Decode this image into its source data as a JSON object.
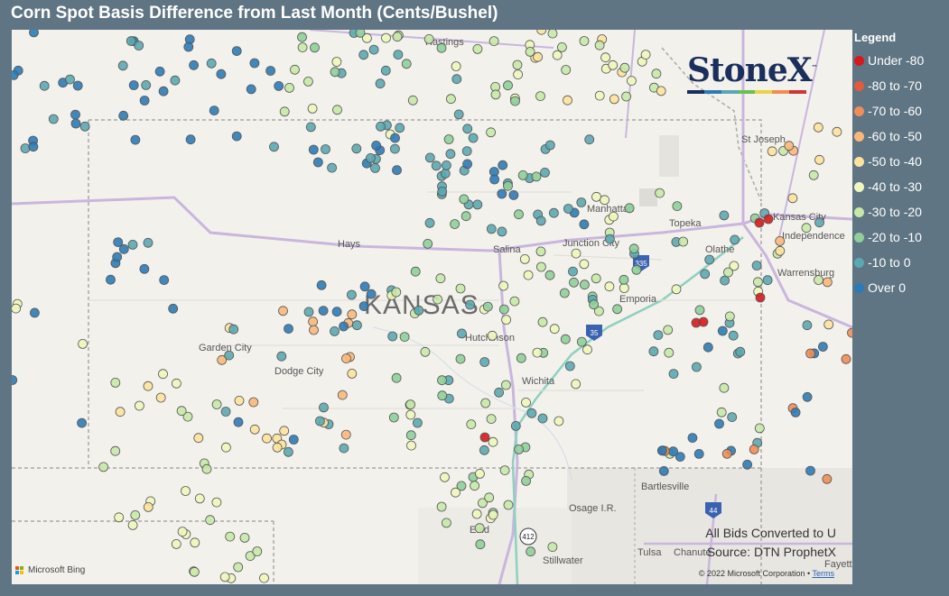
{
  "title": "Corn Spot Basis Difference from Last Month (Cents/Bushel)",
  "legend": {
    "title": "Legend",
    "items": [
      {
        "label": "Under -80",
        "color": "#d7191c"
      },
      {
        "label": "-80 to -70",
        "color": "#e45a3a"
      },
      {
        "label": "-70 to -60",
        "color": "#f08d55"
      },
      {
        "label": "-60 to -50",
        "color": "#f9b87a"
      },
      {
        "label": "-50 to -40",
        "color": "#fde39c"
      },
      {
        "label": "-40 to -30",
        "color": "#eef7bd"
      },
      {
        "label": "-30 to -20",
        "color": "#c8e8a8"
      },
      {
        "label": "-20 to -10",
        "color": "#8fcf9a"
      },
      {
        "label": "-10 to 0",
        "color": "#5ba8b0"
      },
      {
        "label": "Over 0",
        "color": "#2c7bb6"
      }
    ]
  },
  "logo": {
    "text": "StoneX",
    "tm": "™",
    "bar_colors": [
      "#1b2f5c",
      "#2c7bb6",
      "#5ba8b0",
      "#6cbf57",
      "#e8d447",
      "#f08d55",
      "#c8383b"
    ]
  },
  "source": {
    "line1": "All Bids Converted to U",
    "line2": "Source: DTN ProphetX"
  },
  "attribution": {
    "bing": "Microsoft Bing",
    "copyright": "© 2022 Microsoft Corporation",
    "terms": "Terms"
  },
  "map": {
    "state_label": "KANSAS",
    "places": [
      "Hastings",
      "St Joseph",
      "Manhattan",
      "Topeka",
      "Kansas City",
      "Independence",
      "Hays",
      "Salina",
      "Junction City",
      "Olathe",
      "Warrensburg",
      "Emporia",
      "Garden City",
      "Dodge City",
      "Hutchinson",
      "Wichita",
      "Bartlesville",
      "Osage I.R.",
      "Enid",
      "Tulsa",
      "Stillwater",
      "Fayetteville",
      "Chanute"
    ],
    "highway_shields": [
      "335",
      "35",
      "44",
      "412"
    ]
  }
}
